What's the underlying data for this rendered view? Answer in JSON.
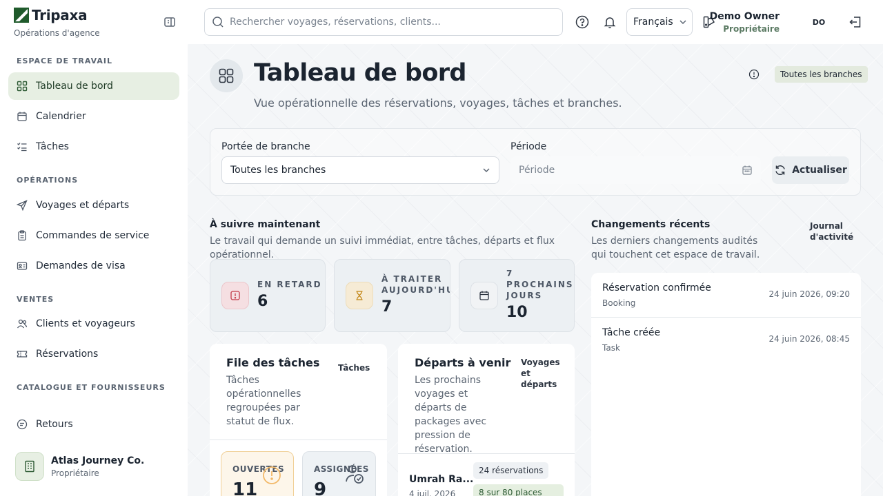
{
  "brand": {
    "name": "Tripaxa",
    "subtitle": "Opérations d'agence"
  },
  "sidebar": {
    "sections": [
      "ESPACE DE TRAVAIL",
      "OPÉRATIONS",
      "VENTES",
      "CATALOGUE ET FOURNISSEURS"
    ],
    "items": [
      {
        "label": "Tableau de bord",
        "icon": "dashboard-icon",
        "active": true
      },
      {
        "label": "Calendrier",
        "icon": "calendar-icon"
      },
      {
        "label": "Tâches",
        "icon": "tasks-icon"
      },
      {
        "label": "Voyages et départs",
        "icon": "plane-icon"
      },
      {
        "label": "Commandes de service",
        "icon": "clipboard-icon"
      },
      {
        "label": "Demandes de visa",
        "icon": "id-card-icon"
      },
      {
        "label": "Clients et voyageurs",
        "icon": "users-icon"
      },
      {
        "label": "Réservations",
        "icon": "ticket-icon"
      },
      {
        "label": "Retours",
        "icon": "message-icon"
      }
    ],
    "org": {
      "name": "Atlas Journey Co.",
      "role": "Propriétaire"
    }
  },
  "topbar": {
    "search_placeholder": "Rechercher voyages, réservations, clients...",
    "language": "Français",
    "user_name": "Demo Owner",
    "user_role": "Propriétaire",
    "avatar_initials": "DO"
  },
  "page": {
    "title": "Tableau de bord",
    "subtitle": "Vue opérationnelle des réservations, voyages, tâches et branches.",
    "branch_badge": "Toutes les branches"
  },
  "filters": {
    "branch_label": "Portée de branche",
    "branch_value": "Toutes les branches",
    "period_label": "Période",
    "period_placeholder": "Période",
    "refresh_label": "Actualiser"
  },
  "follow_up": {
    "title": "À suivre maintenant",
    "subtitle": "Le travail qui demande un suivi immédiat, entre tâches, départs et flux opérationnel.",
    "stats": [
      {
        "label": "EN RETARD",
        "value": "6"
      },
      {
        "label": "À TRAITER AUJOURD'HUI",
        "value": "7"
      },
      {
        "label": "7 PROCHAINS JOURS",
        "value": "10"
      }
    ]
  },
  "task_queue": {
    "title": "File des tâches",
    "link": "Tâches",
    "subtitle": "Tâches opérationnelles regroupées par statut de flux.",
    "open_label": "OUVERTES",
    "open_value": "11",
    "assigned_label": "ASSIGNÉES",
    "assigned_value": "9"
  },
  "departures": {
    "title": "Départs à venir",
    "link": "Voyages et départs",
    "subtitle": "Les prochains voyages et départs de packages avec pression de réservation.",
    "row": {
      "name": "Umrah Ra...",
      "date": "4 juil. 2026",
      "bookings": "24 réservations",
      "seats": "8 sur 80 places"
    }
  },
  "recent_changes": {
    "title": "Changements récents",
    "link": "Journal d'activité",
    "subtitle": "Les derniers changements audités qui touchent cet espace de travail.",
    "rows": [
      {
        "title": "Réservation confirmée",
        "type": "Booking",
        "time": "24 juin 2026, 09:20"
      },
      {
        "title": "Tâche créée",
        "type": "Task",
        "time": "24 juin 2026, 08:45"
      }
    ]
  }
}
